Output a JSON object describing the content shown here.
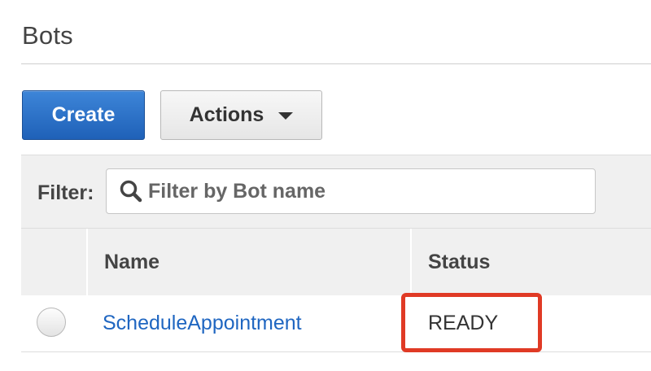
{
  "header": {
    "title": "Bots"
  },
  "toolbar": {
    "create_label": "Create",
    "actions_label": "Actions"
  },
  "filter": {
    "label": "Filter:",
    "placeholder": "Filter by Bot name",
    "value": ""
  },
  "table": {
    "columns": [
      "Name",
      "Status"
    ],
    "rows": [
      {
        "name": "ScheduleAppointment",
        "status": "READY",
        "selected": false
      }
    ]
  },
  "annotation": {
    "highlight_color": "#e03a25",
    "highlighted_cell": "READY"
  },
  "colors": {
    "primary_button": "#1f61b8",
    "link": "#1f66c1"
  },
  "icons": {
    "search": "search-icon",
    "actions_caret": "caret-down-icon"
  }
}
